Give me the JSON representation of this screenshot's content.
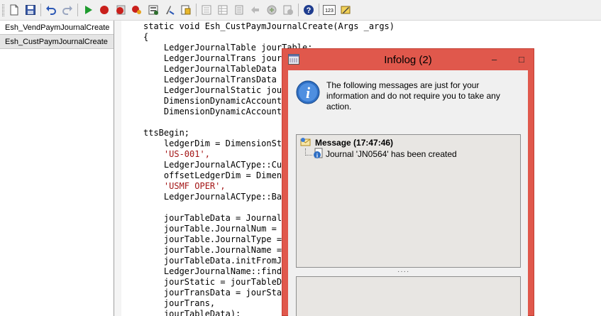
{
  "toolbar": {
    "buttons": [
      "new-icon",
      "save-icon",
      "undo-icon",
      "redo-icon",
      "run-icon",
      "breakpoint-icon",
      "stop-icon",
      "clear-breakpoints-icon",
      "toggle-breakpoint-icon",
      "find-icon",
      "lookup-icon",
      "list-icon",
      "table-icon",
      "indent-icon",
      "go-back-icon",
      "source-control-icon",
      "compile-icon",
      "help-icon",
      "line-number-icon",
      "edit-script-icon"
    ],
    "line_number_badge": "123"
  },
  "methods": [
    {
      "name": "Esh_VendPaymJournalCreate",
      "selected": false
    },
    {
      "name": "Esh_CustPaymJournalCreate",
      "selected": true
    }
  ],
  "code": [
    {
      "text": "static void Esh_CustPaymJournalCreate(Args _args)",
      "type": "normal"
    },
    {
      "text": "{",
      "type": "normal"
    },
    {
      "text": "    LedgerJournalTable jourTable;",
      "type": "normal"
    },
    {
      "text": "    LedgerJournalTrans jourTrans;",
      "type": "normal"
    },
    {
      "text": "    LedgerJournalTableData jourTableData;",
      "type": "normal"
    },
    {
      "text": "    LedgerJournalTransData jourTransData;",
      "type": "normal"
    },
    {
      "text": "    LedgerJournalStatic jourStatic;",
      "type": "normal"
    },
    {
      "text": "    DimensionDynamicAccount ledgerDim;",
      "type": "normal"
    },
    {
      "text": "    DimensionDynamicAccount offsetLedgerDim;",
      "type": "normal"
    },
    {
      "text": "",
      "type": "normal"
    },
    {
      "text": "ttsBegin;",
      "type": "normal"
    },
    {
      "text": "    ledgerDim = DimensionStorage::getDynamicAccount(",
      "type": "normal"
    },
    {
      "text": "    'US-001',",
      "type": "str"
    },
    {
      "text": "    LedgerJournalACType::Cust);",
      "type": "normal"
    },
    {
      "text": "    offsetLedgerDim = DimensionStorage::getDynamicAccount(",
      "type": "normal"
    },
    {
      "text": "    'USMF OPER',",
      "type": "str"
    },
    {
      "text": "    LedgerJournalACType::Bank);",
      "type": "normal"
    },
    {
      "text": "",
      "type": "normal"
    },
    {
      "text": "    jourTableData = JournalTableData::newTable(jourTable);",
      "type": "normal"
    },
    {
      "text": "    jourTable.JournalNum = jourTableData.nextJournalId();",
      "type": "normal"
    },
    {
      "text": "    jourTable.JournalType = LedgerJournalType::CustPayment;",
      "type": "normal"
    },
    {
      "text": "    jourTable.JournalName = 'CustPay';",
      "type": "normal"
    },
    {
      "text": "    jourTableData.initFromJournalName(",
      "type": "normal"
    },
    {
      "text": "    LedgerJournalName::find(jourTable.JournalName));",
      "type": "normal"
    },
    {
      "text": "    jourStatic = jourTableData.journalStatic();",
      "type": "normal"
    },
    {
      "text": "    jourTransData = jourStatic.newJournalTransData(",
      "type": "normal"
    },
    {
      "text": "    jourTrans,",
      "type": "normal"
    },
    {
      "text": "    jourTableData);",
      "type": "normal"
    }
  ],
  "infolog": {
    "title": "Infolog (2)",
    "controls": {
      "minimize": "–",
      "maximize": "□"
    },
    "message_line1": "The following messages are just for your",
    "message_line2": "information and do not require you to take any",
    "message_line3": "action.",
    "tree_header": "Message (17:47:46)",
    "tree_item": "Journal 'JN0564' has been created",
    "splitter": "····"
  }
}
